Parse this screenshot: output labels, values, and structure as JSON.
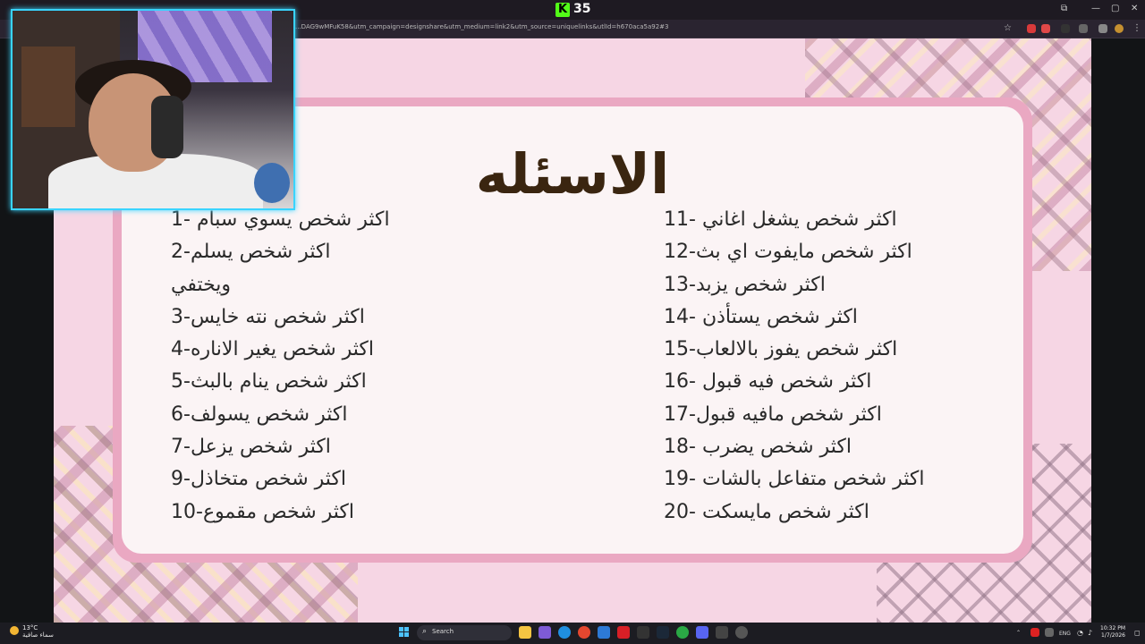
{
  "browser": {
    "kick_logo": "K",
    "kick_viewers": "35",
    "url": "...DAG9wMFuK58&utm_campaign=designshare&utm_medium=link2&utm_source=uniquelinks&utlId=h670aca5a92#3"
  },
  "slide": {
    "title": "الاسئله",
    "left_items": [
      "1- اكثر شخص يسوي سبام",
      "2-اكثر شخص يسلم",
      "ويختفي",
      "3-اكثر شخص نته خايس",
      "4-اكثر شخص يغير الاناره",
      "5-اكثر شخص ينام بالبث",
      "6-اكثر شخص يسولف",
      "7-اكثر شخص يزعل",
      "9-اكثر شخص متخاذل",
      "10-اكثر شخص مقموع"
    ],
    "right_items": [
      "11- اكثر شخص يشغل اغاني",
      "12-اكثر شخص مايفوت اي بث",
      "13-اكثر شخص يزبد",
      "14- اكثر شخص يستأذن",
      "15-اكثر شخص يفوز بالالعاب",
      "16- اكثر شخص فيه قبول",
      "17-اكثر شخص مافيه قبول",
      "18- اكثر شخص يضرب",
      "19- اكثر شخص متفاعل بالشات",
      "20- اكثر شخص مايسكت"
    ]
  },
  "taskbar": {
    "temperature": "13°C",
    "weather_desc": "سماء صافية",
    "search_placeholder": "Search",
    "lang": "ENG",
    "time": "10:32 PM",
    "date": "1/7/2026"
  }
}
